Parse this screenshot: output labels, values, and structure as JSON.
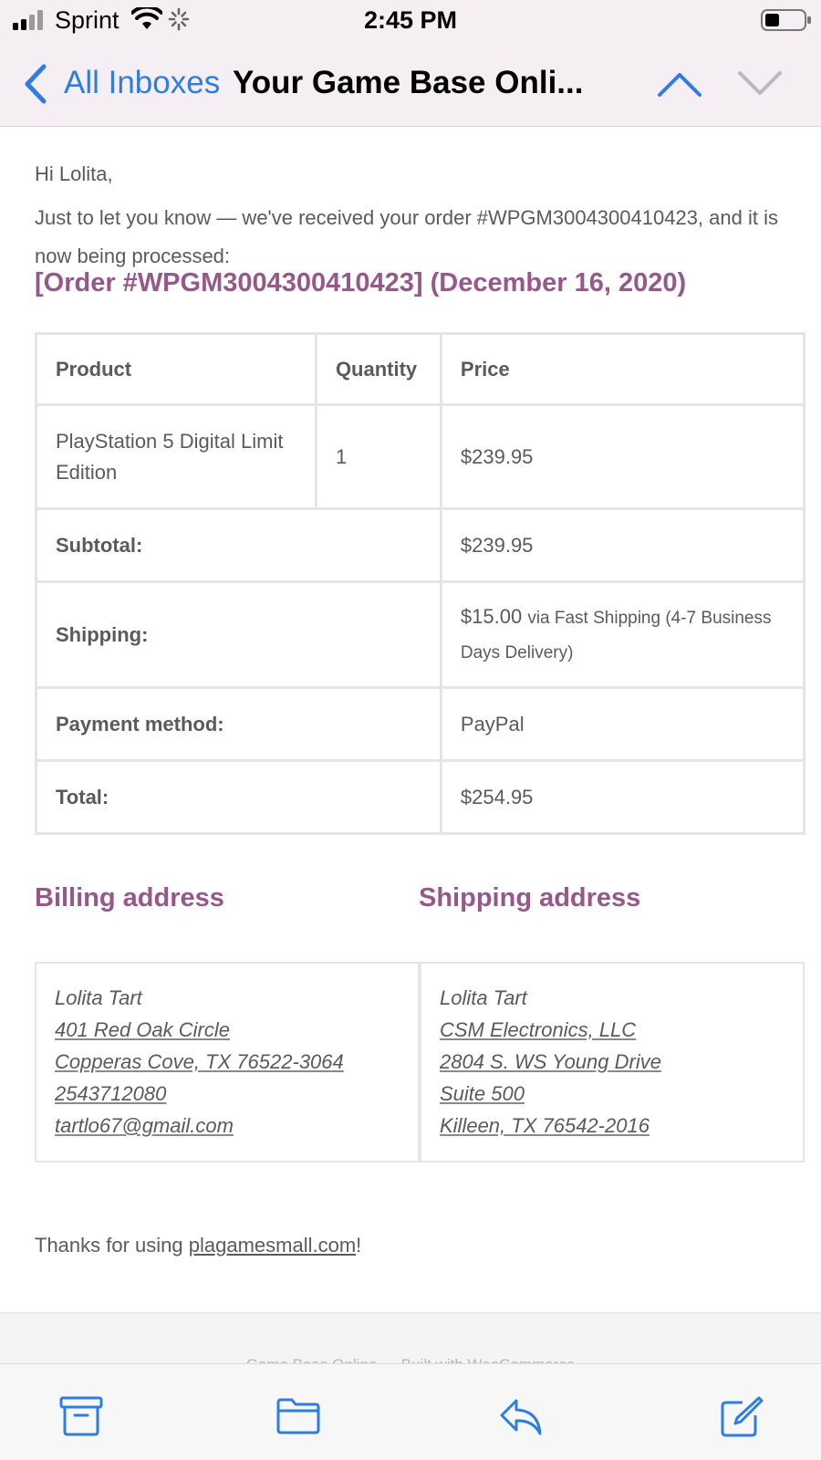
{
  "status_bar": {
    "carrier": "Sprint",
    "time": "2:45 PM"
  },
  "nav": {
    "back_label": "All Inboxes",
    "subject": "Your Game Base Onli..."
  },
  "email": {
    "greeting": "Hi Lolita,",
    "intro": "Just to let you know — we've received your order #WPGM3004300410423, and it is now being processed:",
    "order_heading": "[Order #WPGM3004300410423] (December 16, 2020)",
    "table": {
      "headers": [
        "Product",
        "Quantity",
        "Price"
      ],
      "item": {
        "product": "PlayStation 5 Digital Limit Edition",
        "quantity": "1",
        "price": "$239.95"
      },
      "subtotal": {
        "label": "Subtotal:",
        "value": "$239.95"
      },
      "shipping": {
        "label": "Shipping:",
        "amount": "$15.00",
        "method": "via Fast Shipping (4-7 Business Days Delivery)"
      },
      "payment": {
        "label": "Payment method:",
        "value": "PayPal"
      },
      "total": {
        "label": "Total:",
        "value": "$254.95"
      }
    },
    "billing": {
      "heading": "Billing address",
      "lines": [
        "Lolita Tart",
        "401 Red Oak Circle",
        "Copperas Cove, TX 76522-3064",
        "2543712080",
        "tartlo67@gmail.com"
      ]
    },
    "shipping_address": {
      "heading": "Shipping address",
      "lines": [
        "Lolita Tart",
        "CSM Electronics, LLC",
        "2804 S. WS Young Drive",
        "Suite 500",
        "Killeen, TX 76542-2016"
      ]
    },
    "thanks_prefix": "Thanks for using ",
    "thanks_link": "plagamesmall.com",
    "thanks_suffix": "!",
    "footer": "Game Base Online — Built with WooCommerce"
  },
  "toolbar": {
    "icons": [
      "archive-icon",
      "folder-icon",
      "reply-icon",
      "compose-icon"
    ]
  },
  "colors": {
    "accent": "#96588a",
    "ios_blue": "#2f7de1",
    "text": "#5a5a5a",
    "border": "#e5e5e5",
    "header_bg": "#f5eef3"
  }
}
